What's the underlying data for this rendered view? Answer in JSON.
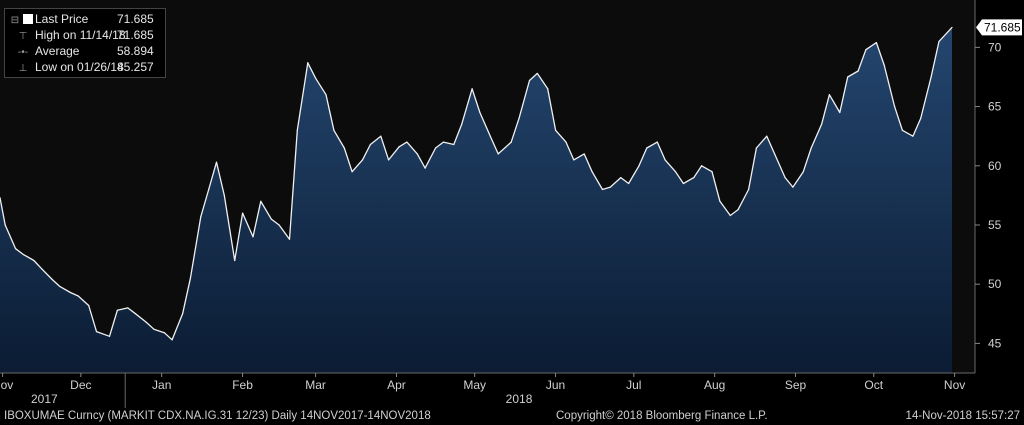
{
  "legend": {
    "items": [
      {
        "label": "Last Price",
        "value": "71.685"
      },
      {
        "label": "High on 11/14/18",
        "value": "71.685"
      },
      {
        "label": "Average",
        "value": "58.894"
      },
      {
        "label": "Low on 01/26/18",
        "value": "45.257"
      }
    ]
  },
  "footer": {
    "left": "IBOXUMAE Curncy (MARKIT CDX.NA.IG.31 12/23)  Daily 14NOV2017-14NOV2018",
    "center": "Copyright© 2018 Bloomberg Finance L.P.",
    "right": "14-Nov-2018 15:57:27"
  },
  "colors": {
    "background": "#000000",
    "plot_bg": "#101010",
    "line": "#f0f0f0",
    "fill_top": "#1e3d63",
    "fill_bottom": "#0a1a30",
    "last_price_tag": "#ffffff"
  },
  "chart_data": {
    "type": "area",
    "title": "",
    "xlabel": "",
    "ylabel": "",
    "ylim": [
      42.5,
      74
    ],
    "y_ticks": [
      45,
      50,
      55,
      60,
      65,
      70
    ],
    "x_ticks": [
      {
        "label": "Nov",
        "date": "2017-11-15"
      },
      {
        "label": "Dec",
        "date": "2017-12-15"
      },
      {
        "label": "Jan",
        "date": "2018-01-15"
      },
      {
        "label": "Feb",
        "date": "2018-02-15"
      },
      {
        "label": "Mar",
        "date": "2018-03-15"
      },
      {
        "label": "Apr",
        "date": "2018-04-15"
      },
      {
        "label": "May",
        "date": "2018-05-15"
      },
      {
        "label": "Jun",
        "date": "2018-06-15"
      },
      {
        "label": "Jul",
        "date": "2018-07-15"
      },
      {
        "label": "Aug",
        "date": "2018-08-15"
      },
      {
        "label": "Sep",
        "date": "2018-09-15"
      },
      {
        "label": "Oct",
        "date": "2018-10-15"
      },
      {
        "label": "Nov",
        "date": "2018-11-15"
      }
    ],
    "year_labels": [
      {
        "label": "2017",
        "date": "2017-12-01"
      },
      {
        "label": "2018",
        "date": "2018-06-01"
      }
    ],
    "year_separators": [
      "2018-01-01"
    ],
    "last_value_tag": "71.685",
    "series": [
      {
        "x": [
          "2017-11-14",
          "2017-11-16",
          "2017-11-20",
          "2017-11-23",
          "2017-11-27",
          "2017-11-30",
          "2017-12-04",
          "2017-12-07",
          "2017-12-11",
          "2017-12-14",
          "2017-12-18",
          "2017-12-21",
          "2017-12-26",
          "2017-12-29",
          "2018-01-02",
          "2018-01-05",
          "2018-01-09",
          "2018-01-12",
          "2018-01-16",
          "2018-01-19",
          "2018-01-23",
          "2018-01-26",
          "2018-01-30",
          "2018-02-02",
          "2018-02-05",
          "2018-02-08",
          "2018-02-12",
          "2018-02-15",
          "2018-02-19",
          "2018-02-22",
          "2018-02-26",
          "2018-03-01",
          "2018-03-05",
          "2018-03-08",
          "2018-03-12",
          "2018-03-15",
          "2018-03-19",
          "2018-03-22",
          "2018-03-26",
          "2018-03-29",
          "2018-04-02",
          "2018-04-05",
          "2018-04-09",
          "2018-04-12",
          "2018-04-16",
          "2018-04-19",
          "2018-04-23",
          "2018-04-26",
          "2018-04-30",
          "2018-05-03",
          "2018-05-07",
          "2018-05-10",
          "2018-05-14",
          "2018-05-17",
          "2018-05-21",
          "2018-05-24",
          "2018-05-29",
          "2018-06-01",
          "2018-06-05",
          "2018-06-08",
          "2018-06-12",
          "2018-06-15",
          "2018-06-19",
          "2018-06-22",
          "2018-06-26",
          "2018-06-29",
          "2018-07-03",
          "2018-07-06",
          "2018-07-10",
          "2018-07-13",
          "2018-07-17",
          "2018-07-20",
          "2018-07-24",
          "2018-07-27",
          "2018-07-31",
          "2018-08-03",
          "2018-08-07",
          "2018-08-10",
          "2018-08-14",
          "2018-08-17",
          "2018-08-21",
          "2018-08-24",
          "2018-08-28",
          "2018-08-31",
          "2018-09-04",
          "2018-09-07",
          "2018-09-11",
          "2018-09-14",
          "2018-09-18",
          "2018-09-21",
          "2018-09-25",
          "2018-09-28",
          "2018-10-02",
          "2018-10-05",
          "2018-10-09",
          "2018-10-12",
          "2018-10-16",
          "2018-10-19",
          "2018-10-23",
          "2018-10-26",
          "2018-10-30",
          "2018-11-02",
          "2018-11-06",
          "2018-11-09",
          "2018-11-14"
        ],
        "y": [
          57.3,
          55.0,
          53.0,
          52.5,
          52.0,
          51.3,
          50.4,
          49.8,
          49.3,
          49.0,
          48.2,
          46.0,
          45.6,
          47.8,
          48.0,
          47.5,
          46.8,
          46.2,
          45.9,
          45.3,
          47.5,
          50.5,
          55.7,
          58.0,
          60.3,
          57.5,
          52.0,
          56.0,
          54.0,
          57.0,
          55.5,
          55.0,
          53.8,
          63.0,
          68.7,
          67.4,
          66.0,
          63.0,
          61.5,
          59.5,
          60.5,
          61.8,
          62.5,
          60.5,
          61.6,
          62.0,
          61.0,
          59.8,
          61.5,
          62.0,
          61.8,
          63.5,
          66.5,
          64.5,
          62.5,
          61.0,
          62.0,
          64.0,
          67.2,
          67.8,
          66.5,
          63.0,
          62.0,
          60.5,
          61.0,
          59.5,
          58.0,
          58.2,
          59.0,
          58.5,
          60.0,
          61.5,
          62.0,
          60.5,
          59.5,
          58.5,
          59.0,
          60.0,
          59.5,
          57.0,
          55.8,
          56.3,
          58.0,
          61.5,
          62.5,
          61.0,
          59.0,
          58.2,
          59.5,
          61.5,
          63.5,
          66.0,
          64.5,
          67.5,
          68.0,
          69.8,
          70.4,
          68.5,
          65.0,
          63.0,
          62.5,
          64.0,
          67.5,
          70.5,
          71.685
        ]
      }
    ]
  }
}
